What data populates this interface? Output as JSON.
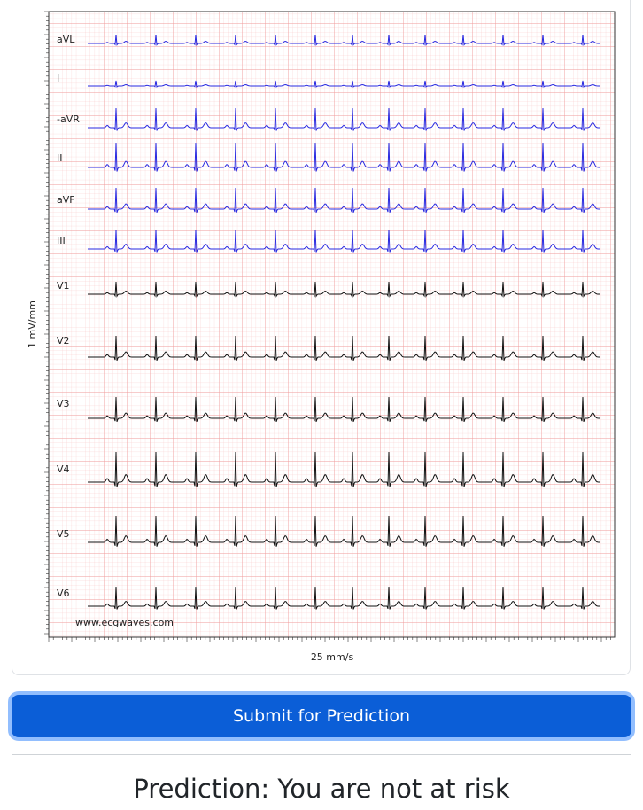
{
  "ecg": {
    "leads": [
      {
        "label": "aVL",
        "color": "#2a2ae0"
      },
      {
        "label": "I",
        "color": "#2a2ae0"
      },
      {
        "label": "-aVR",
        "color": "#2a2ae0"
      },
      {
        "label": "II",
        "color": "#2a2ae0"
      },
      {
        "label": "aVF",
        "color": "#2a2ae0"
      },
      {
        "label": "III",
        "color": "#2a2ae0"
      },
      {
        "label": "V1",
        "color": "#111111"
      },
      {
        "label": "V2",
        "color": "#111111"
      },
      {
        "label": "V3",
        "color": "#111111"
      },
      {
        "label": "V4",
        "color": "#111111"
      },
      {
        "label": "V5",
        "color": "#111111"
      },
      {
        "label": "V6",
        "color": "#111111"
      }
    ],
    "y_axis_label": "1 mV/mm",
    "x_axis_label": "25 mm/s",
    "watermark": "www.ecgwaves.com",
    "grid_color": "#f4a9a9"
  },
  "form": {
    "submit_label": "Submit for Prediction"
  },
  "result": {
    "prediction_text": "Prediction: You are not at risk"
  }
}
